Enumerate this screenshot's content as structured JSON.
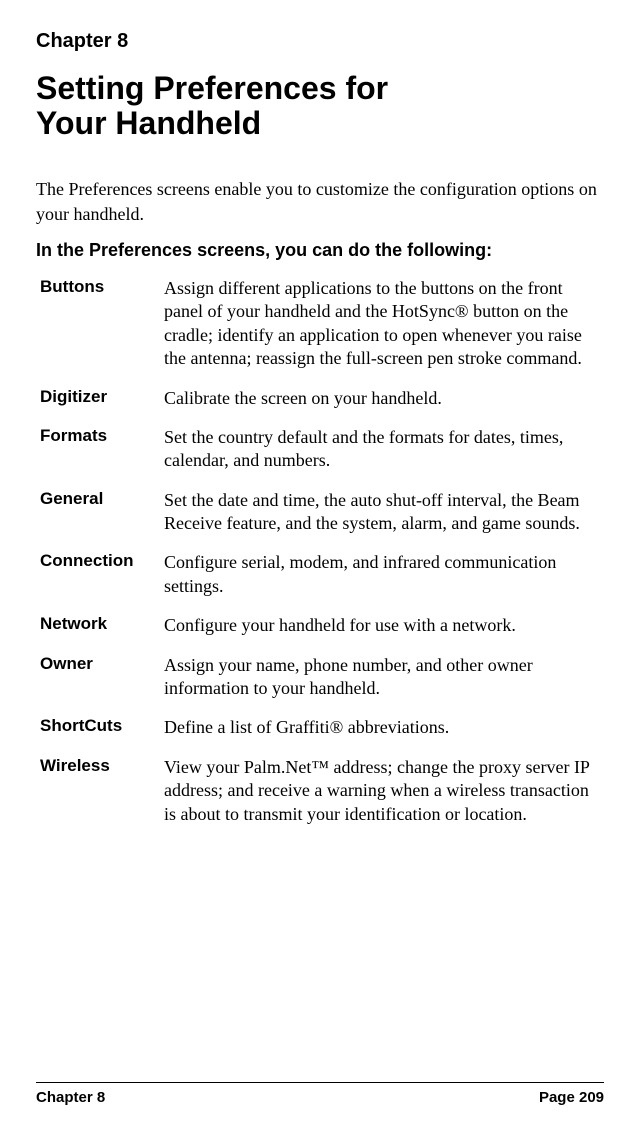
{
  "chapter_label": "Chapter 8",
  "chapter_title_line1": "Setting Preferences for",
  "chapter_title_line2": "Your Handheld",
  "intro": "The Preferences screens enable you to customize the configuration options on your handheld.",
  "section_heading": "In the Preferences screens, you can do the following:",
  "prefs": [
    {
      "label": "Buttons",
      "desc": "Assign different applications to the buttons on the front panel of your handheld and the HotSync® button on the cradle; identify an application to open whenever you raise the antenna; reassign the full-screen pen stroke command."
    },
    {
      "label": "Digitizer",
      "desc": "Calibrate the screen on your handheld."
    },
    {
      "label": "Formats",
      "desc": "Set the country default and the formats for dates, times, calendar, and numbers."
    },
    {
      "label": "General",
      "desc": "Set the date and time, the auto shut-off interval, the Beam Receive feature, and the system, alarm, and game sounds."
    },
    {
      "label": "Connection",
      "desc": "Configure serial, modem, and infrared communication settings."
    },
    {
      "label": "Network",
      "desc": "Configure your handheld for use with a network."
    },
    {
      "label": "Owner",
      "desc": "Assign your name, phone number, and other owner information to your handheld."
    },
    {
      "label": "ShortCuts",
      "desc": "Define a list of Graffiti® abbreviations."
    },
    {
      "label": "Wireless",
      "desc": "View your Palm.Net™ address; change the proxy server IP address; and receive a warning when a wireless transaction is about to transmit your identification or location."
    }
  ],
  "footer_left": "Chapter 8",
  "footer_right": "Page 209"
}
